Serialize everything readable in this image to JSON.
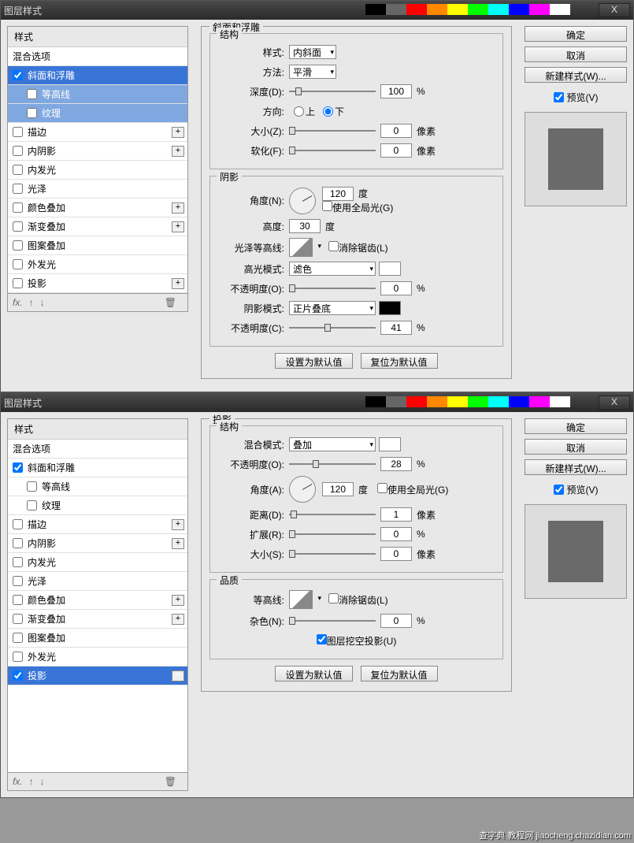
{
  "dialogs": [
    {
      "title": "图层样式",
      "closeLabel": "X",
      "styleHeader": "样式",
      "blendOptions": "混合选项",
      "items": [
        {
          "label": "斜面和浮雕",
          "checked": true,
          "selected": true,
          "plus": false
        },
        {
          "label": "等高线",
          "checked": false,
          "sub": true,
          "subsel": true
        },
        {
          "label": "纹理",
          "checked": false,
          "sub": true,
          "subsel": true
        },
        {
          "label": "描边",
          "checked": false,
          "plus": true
        },
        {
          "label": "内阴影",
          "checked": false,
          "plus": true
        },
        {
          "label": "内发光",
          "checked": false
        },
        {
          "label": "光泽",
          "checked": false
        },
        {
          "label": "颜色叠加",
          "checked": false,
          "plus": true
        },
        {
          "label": "渐变叠加",
          "checked": false,
          "plus": true
        },
        {
          "label": "图案叠加",
          "checked": false
        },
        {
          "label": "外发光",
          "checked": false
        },
        {
          "label": "投影",
          "checked": false,
          "plus": true
        }
      ],
      "fxLabel": "fx.",
      "mainTitle": "斜面和浮雕",
      "group1": {
        "title": "结构",
        "styleLabel": "样式:",
        "styleVal": "内斜面",
        "methodLabel": "方法:",
        "methodVal": "平滑",
        "depthLabel": "深度(D):",
        "depthVal": "100",
        "depthUnit": "%",
        "dirLabel": "方向:",
        "up": "上",
        "down": "下",
        "sizeLabel": "大小(Z):",
        "sizeVal": "0",
        "sizeUnit": "像素",
        "softLabel": "软化(F):",
        "softVal": "0",
        "softUnit": "像素"
      },
      "group2": {
        "title": "阴影",
        "angleLabel": "角度(N):",
        "angleVal": "120",
        "angleUnit": "度",
        "globalLabel": "使用全局光(G)",
        "altLabel": "高度:",
        "altVal": "30",
        "altUnit": "度",
        "glossLabel": "光泽等高线:",
        "antiLabel": "消除锯齿(L)",
        "hiLabel": "高光模式:",
        "hiVal": "滤色",
        "hiOpLabel": "不透明度(O):",
        "hiOpVal": "0",
        "hiOpUnit": "%",
        "shLabel": "阴影模式:",
        "shVal": "正片叠底",
        "shOpLabel": "不透明度(C):",
        "shOpVal": "41",
        "shOpUnit": "%"
      },
      "defaultBtn": "设置为默认值",
      "resetBtn": "复位为默认值",
      "okBtn": "确定",
      "cancelBtn": "取消",
      "newStyleBtn": "新建样式(W)...",
      "previewLabel": "预览(V)"
    },
    {
      "title": "图层样式",
      "closeLabel": "X",
      "styleHeader": "样式",
      "blendOptions": "混合选项",
      "items": [
        {
          "label": "斜面和浮雕",
          "checked": true,
          "plus": false
        },
        {
          "label": "等高线",
          "checked": false,
          "sub": true
        },
        {
          "label": "纹理",
          "checked": false,
          "sub": true
        },
        {
          "label": "描边",
          "checked": false,
          "plus": true
        },
        {
          "label": "内阴影",
          "checked": false,
          "plus": true
        },
        {
          "label": "内发光",
          "checked": false
        },
        {
          "label": "光泽",
          "checked": false
        },
        {
          "label": "颜色叠加",
          "checked": false,
          "plus": true
        },
        {
          "label": "渐变叠加",
          "checked": false,
          "plus": true
        },
        {
          "label": "图案叠加",
          "checked": false
        },
        {
          "label": "外发光",
          "checked": false
        },
        {
          "label": "投影",
          "checked": true,
          "selected": true,
          "plus": true
        }
      ],
      "fxLabel": "fx.",
      "mainTitle": "投影",
      "group1": {
        "title": "结构",
        "blendLabel": "混合模式:",
        "blendVal": "叠加",
        "opLabel": "不透明度(O):",
        "opVal": "28",
        "opUnit": "%",
        "angleLabel": "角度(A):",
        "angleVal": "120",
        "angleUnit": "度",
        "globalLabel": "使用全局光(G)",
        "distLabel": "距离(D):",
        "distVal": "1",
        "distUnit": "像素",
        "spreadLabel": "扩展(R):",
        "spreadVal": "0",
        "spreadUnit": "%",
        "sizeLabel": "大小(S):",
        "sizeVal": "0",
        "sizeUnit": "像素"
      },
      "group2": {
        "title": "品质",
        "contourLabel": "等高线:",
        "antiLabel": "消除锯齿(L)",
        "noiseLabel": "杂色(N):",
        "noiseVal": "0",
        "noiseUnit": "%",
        "knockLabel": "图层挖空投影(U)"
      },
      "defaultBtn": "设置为默认值",
      "resetBtn": "复位为默认值",
      "okBtn": "确定",
      "cancelBtn": "取消",
      "newStyleBtn": "新建样式(W)...",
      "previewLabel": "预览(V)"
    }
  ],
  "colorbar": [
    "#000",
    "#666",
    "#f00",
    "#f80",
    "#ff0",
    "#0f0",
    "#0ff",
    "#00f",
    "#f0f",
    "#fff"
  ],
  "watermark": "查字典 教程网 jiaocheng.chazidian.com"
}
